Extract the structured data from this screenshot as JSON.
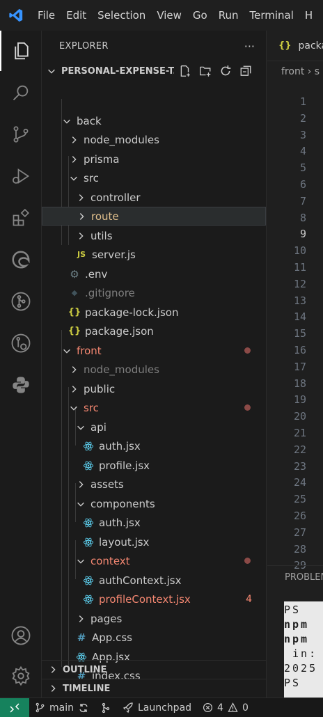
{
  "menubar": {
    "items": [
      "File",
      "Edit",
      "Selection",
      "View",
      "Go",
      "Run",
      "Terminal",
      "H"
    ]
  },
  "activity_bar": {
    "items": [
      "explorer-icon",
      "search-icon",
      "source-control-icon",
      "run-debug-icon",
      "extensions-icon",
      "edge-icon",
      "git-graph-icon",
      "remote-explorer-icon",
      "python-icon",
      "account-icon",
      "settings-icon"
    ]
  },
  "explorer": {
    "title": "EXPLORER",
    "more": "···",
    "root": "PERSONAL-EXPENSE-T...",
    "tree": [
      {
        "label": "back",
        "kind": "folder-open"
      },
      {
        "label": "node_modules",
        "kind": "folder"
      },
      {
        "label": "prisma",
        "kind": "folder"
      },
      {
        "label": "src",
        "kind": "folder-open"
      },
      {
        "label": "controller",
        "kind": "folder"
      },
      {
        "label": "route",
        "kind": "folder"
      },
      {
        "label": "utils",
        "kind": "folder"
      },
      {
        "label": "server.js",
        "kind": "file",
        "icon": "JS"
      },
      {
        "label": ".env",
        "kind": "file",
        "icon": "gear"
      },
      {
        "label": ".gitignore",
        "kind": "file",
        "icon": "git"
      },
      {
        "label": "package-lock.json",
        "kind": "file",
        "icon": "{}"
      },
      {
        "label": "package.json",
        "kind": "file",
        "icon": "{}"
      },
      {
        "label": "front",
        "kind": "folder-open"
      },
      {
        "label": "node_modules",
        "kind": "folder"
      },
      {
        "label": "public",
        "kind": "folder"
      },
      {
        "label": "src",
        "kind": "folder-open"
      },
      {
        "label": "api",
        "kind": "folder-open"
      },
      {
        "label": "auth.jsx",
        "kind": "file",
        "icon": "react"
      },
      {
        "label": "profile.jsx",
        "kind": "file",
        "icon": "react"
      },
      {
        "label": "assets",
        "kind": "folder"
      },
      {
        "label": "components",
        "kind": "folder-open"
      },
      {
        "label": "auth.jsx",
        "kind": "file",
        "icon": "react"
      },
      {
        "label": "layout.jsx",
        "kind": "file",
        "icon": "react"
      },
      {
        "label": "context",
        "kind": "folder-open"
      },
      {
        "label": "authContext.jsx",
        "kind": "file",
        "icon": "react"
      },
      {
        "label": "profileContext.jsx",
        "kind": "file",
        "icon": "react",
        "badge": "4"
      },
      {
        "label": "pages",
        "kind": "folder"
      },
      {
        "label": "App.css",
        "kind": "file",
        "icon": "#"
      },
      {
        "label": "App.jsx",
        "kind": "file",
        "icon": "react"
      },
      {
        "label": "index.css",
        "kind": "file",
        "icon": "#"
      }
    ],
    "outline": "OUTLINE",
    "timeline": "TIMELINE"
  },
  "editor": {
    "tab_icon": "{}",
    "tab_label": "packa",
    "breadcrumb": "front › s",
    "line_numbers": [
      "1",
      "2",
      "3",
      "4",
      "5",
      "6",
      "7",
      "8",
      "9",
      "10",
      "11",
      "12",
      "13",
      "14",
      "15",
      "16",
      "17",
      "18",
      "19",
      "20",
      "21",
      "22",
      "23",
      "24",
      "25",
      "26",
      "27",
      "28",
      "29"
    ],
    "panel_tab": "PROBLEM",
    "terminal_lines": [
      "PS ",
      "npm",
      "npm",
      " in:",
      "2025",
      "PS "
    ]
  },
  "statusbar": {
    "branch": "main",
    "launchpad": "Launchpad",
    "errors": "4",
    "warnings": "0"
  },
  "colors": {
    "accent_blue": "#3794ff",
    "error_red": "#f48771",
    "json_yellow": "#cbcb41",
    "react_blue": "#61dafb",
    "css_blue": "#519aba",
    "remote_green": "#16825d"
  }
}
